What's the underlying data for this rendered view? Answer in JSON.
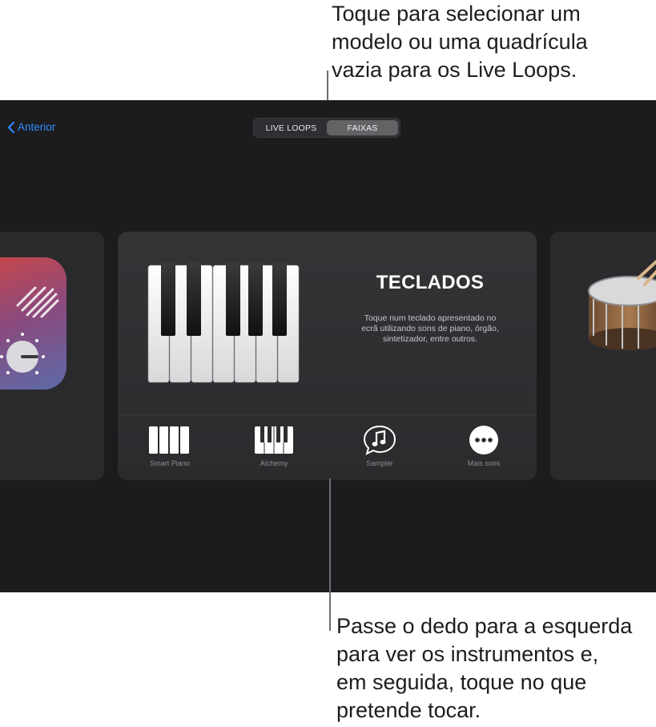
{
  "callouts": {
    "top": [
      "Toque para selecionar um",
      "modelo ou uma quadrícula",
      "vazia para os Live Loops."
    ],
    "bottom": [
      "Passe o dedo para a esquerda",
      "para ver os instrumentos e,",
      "em seguida, toque no que",
      "pretende tocar."
    ]
  },
  "nav": {
    "back_label": "Anterior"
  },
  "segmented": {
    "options": [
      "LIVE LOOPS",
      "FAIXAS"
    ],
    "selected": "FAIXAS"
  },
  "card": {
    "title": "TECLADOS",
    "description": [
      "Toque num teclado apresentado no",
      "ecrã utilizando sons de piano, órgão,",
      "sintetizador, entre outros."
    ],
    "options": [
      {
        "label": "Smart Piano",
        "icon": "smart-piano-icon"
      },
      {
        "label": "Alchemy",
        "icon": "alchemy-keyboard-icon"
      },
      {
        "label": "Sampler",
        "icon": "sampler-music-note-icon"
      },
      {
        "label": "Mais sons",
        "icon": "more-ellipsis-icon"
      }
    ]
  },
  "colors": {
    "accent": "#2f8cff",
    "screen_bg": "#1c1c1e",
    "card_bg": "#2c2c2e"
  }
}
